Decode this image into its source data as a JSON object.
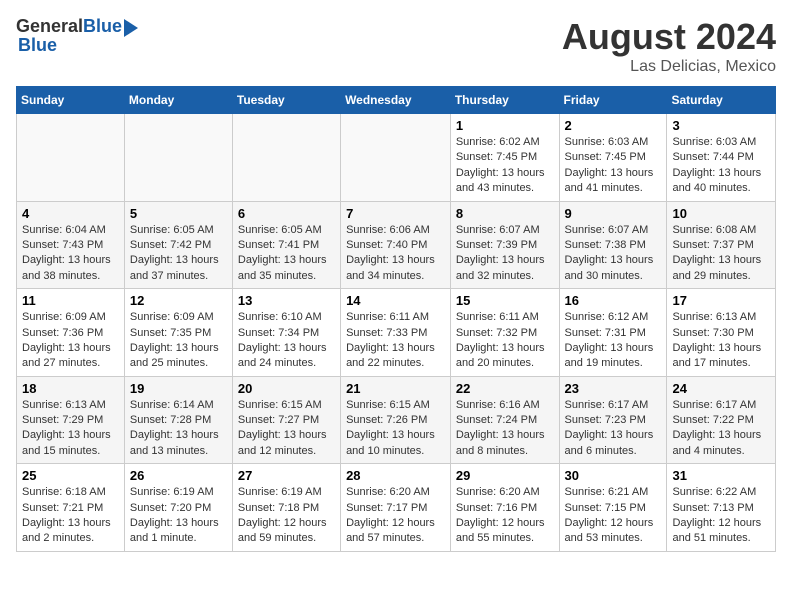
{
  "header": {
    "logo": {
      "general": "General",
      "blue": "Blue"
    },
    "month_year": "August 2024",
    "location": "Las Delicias, Mexico"
  },
  "days_of_week": [
    "Sunday",
    "Monday",
    "Tuesday",
    "Wednesday",
    "Thursday",
    "Friday",
    "Saturday"
  ],
  "weeks": [
    [
      {
        "day": "",
        "info": ""
      },
      {
        "day": "",
        "info": ""
      },
      {
        "day": "",
        "info": ""
      },
      {
        "day": "",
        "info": ""
      },
      {
        "day": "1",
        "info": "Sunrise: 6:02 AM\nSunset: 7:45 PM\nDaylight: 13 hours and 43 minutes."
      },
      {
        "day": "2",
        "info": "Sunrise: 6:03 AM\nSunset: 7:45 PM\nDaylight: 13 hours and 41 minutes."
      },
      {
        "day": "3",
        "info": "Sunrise: 6:03 AM\nSunset: 7:44 PM\nDaylight: 13 hours and 40 minutes."
      }
    ],
    [
      {
        "day": "4",
        "info": "Sunrise: 6:04 AM\nSunset: 7:43 PM\nDaylight: 13 hours and 38 minutes."
      },
      {
        "day": "5",
        "info": "Sunrise: 6:05 AM\nSunset: 7:42 PM\nDaylight: 13 hours and 37 minutes."
      },
      {
        "day": "6",
        "info": "Sunrise: 6:05 AM\nSunset: 7:41 PM\nDaylight: 13 hours and 35 minutes."
      },
      {
        "day": "7",
        "info": "Sunrise: 6:06 AM\nSunset: 7:40 PM\nDaylight: 13 hours and 34 minutes."
      },
      {
        "day": "8",
        "info": "Sunrise: 6:07 AM\nSunset: 7:39 PM\nDaylight: 13 hours and 32 minutes."
      },
      {
        "day": "9",
        "info": "Sunrise: 6:07 AM\nSunset: 7:38 PM\nDaylight: 13 hours and 30 minutes."
      },
      {
        "day": "10",
        "info": "Sunrise: 6:08 AM\nSunset: 7:37 PM\nDaylight: 13 hours and 29 minutes."
      }
    ],
    [
      {
        "day": "11",
        "info": "Sunrise: 6:09 AM\nSunset: 7:36 PM\nDaylight: 13 hours and 27 minutes."
      },
      {
        "day": "12",
        "info": "Sunrise: 6:09 AM\nSunset: 7:35 PM\nDaylight: 13 hours and 25 minutes."
      },
      {
        "day": "13",
        "info": "Sunrise: 6:10 AM\nSunset: 7:34 PM\nDaylight: 13 hours and 24 minutes."
      },
      {
        "day": "14",
        "info": "Sunrise: 6:11 AM\nSunset: 7:33 PM\nDaylight: 13 hours and 22 minutes."
      },
      {
        "day": "15",
        "info": "Sunrise: 6:11 AM\nSunset: 7:32 PM\nDaylight: 13 hours and 20 minutes."
      },
      {
        "day": "16",
        "info": "Sunrise: 6:12 AM\nSunset: 7:31 PM\nDaylight: 13 hours and 19 minutes."
      },
      {
        "day": "17",
        "info": "Sunrise: 6:13 AM\nSunset: 7:30 PM\nDaylight: 13 hours and 17 minutes."
      }
    ],
    [
      {
        "day": "18",
        "info": "Sunrise: 6:13 AM\nSunset: 7:29 PM\nDaylight: 13 hours and 15 minutes."
      },
      {
        "day": "19",
        "info": "Sunrise: 6:14 AM\nSunset: 7:28 PM\nDaylight: 13 hours and 13 minutes."
      },
      {
        "day": "20",
        "info": "Sunrise: 6:15 AM\nSunset: 7:27 PM\nDaylight: 13 hours and 12 minutes."
      },
      {
        "day": "21",
        "info": "Sunrise: 6:15 AM\nSunset: 7:26 PM\nDaylight: 13 hours and 10 minutes."
      },
      {
        "day": "22",
        "info": "Sunrise: 6:16 AM\nSunset: 7:24 PM\nDaylight: 13 hours and 8 minutes."
      },
      {
        "day": "23",
        "info": "Sunrise: 6:17 AM\nSunset: 7:23 PM\nDaylight: 13 hours and 6 minutes."
      },
      {
        "day": "24",
        "info": "Sunrise: 6:17 AM\nSunset: 7:22 PM\nDaylight: 13 hours and 4 minutes."
      }
    ],
    [
      {
        "day": "25",
        "info": "Sunrise: 6:18 AM\nSunset: 7:21 PM\nDaylight: 13 hours and 2 minutes."
      },
      {
        "day": "26",
        "info": "Sunrise: 6:19 AM\nSunset: 7:20 PM\nDaylight: 13 hours and 1 minute."
      },
      {
        "day": "27",
        "info": "Sunrise: 6:19 AM\nSunset: 7:18 PM\nDaylight: 12 hours and 59 minutes."
      },
      {
        "day": "28",
        "info": "Sunrise: 6:20 AM\nSunset: 7:17 PM\nDaylight: 12 hours and 57 minutes."
      },
      {
        "day": "29",
        "info": "Sunrise: 6:20 AM\nSunset: 7:16 PM\nDaylight: 12 hours and 55 minutes."
      },
      {
        "day": "30",
        "info": "Sunrise: 6:21 AM\nSunset: 7:15 PM\nDaylight: 12 hours and 53 minutes."
      },
      {
        "day": "31",
        "info": "Sunrise: 6:22 AM\nSunset: 7:13 PM\nDaylight: 12 hours and 51 minutes."
      }
    ]
  ]
}
